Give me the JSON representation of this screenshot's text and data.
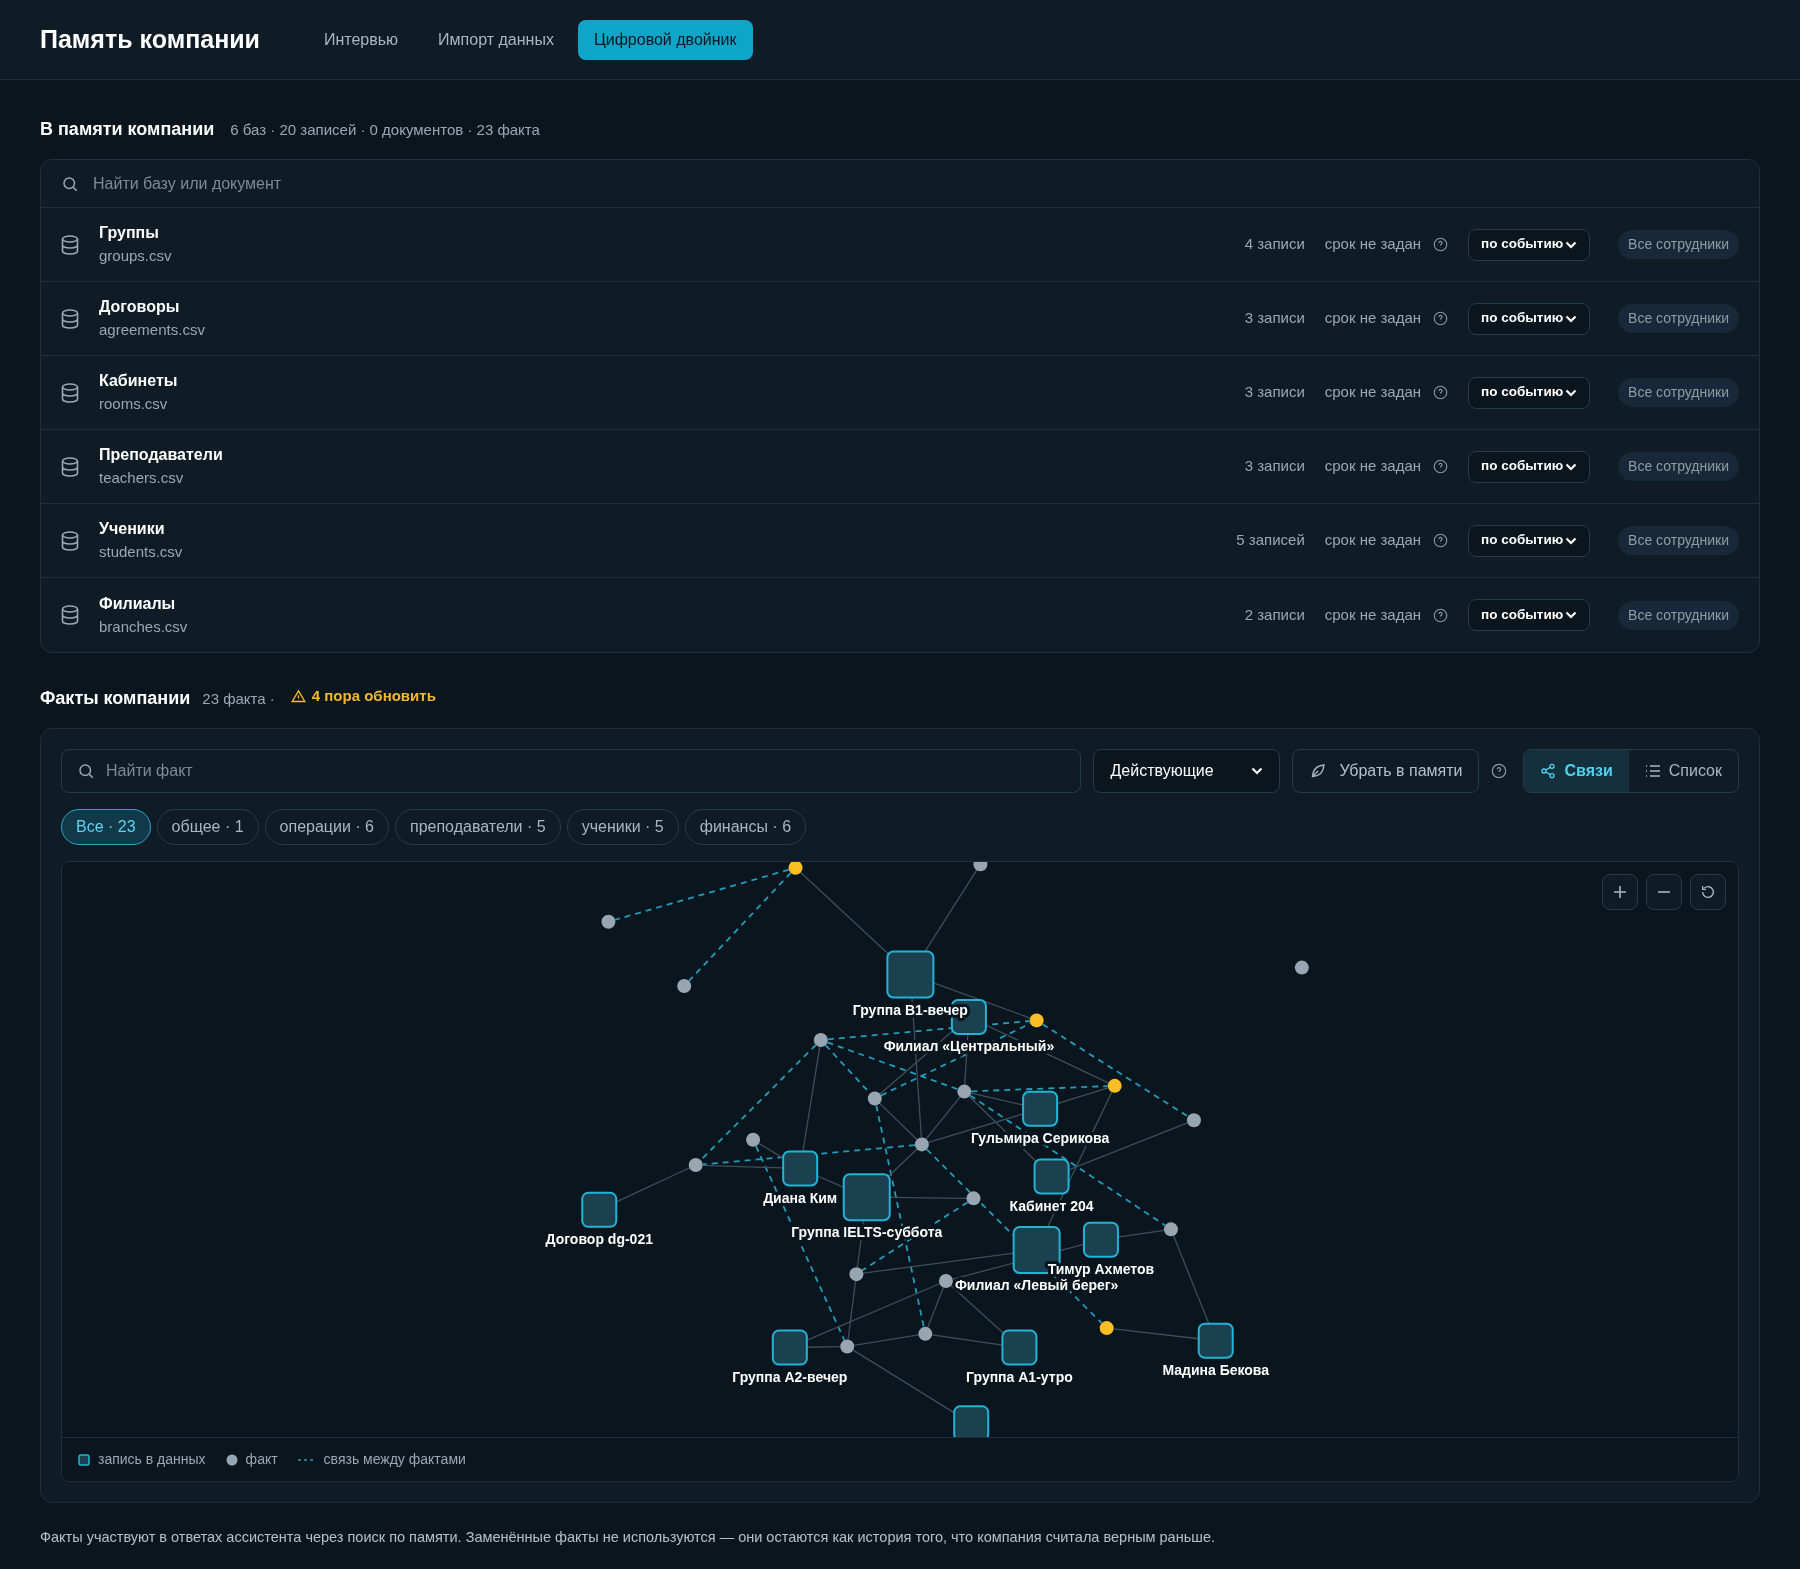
{
  "app": {
    "title": "Память компании",
    "tabs": [
      {
        "label": "Интервью",
        "selected": false
      },
      {
        "label": "Импорт данных",
        "selected": false
      },
      {
        "label": "Цифровой двойник",
        "selected": true
      }
    ]
  },
  "memory": {
    "title": "В памяти компании",
    "summary": "6 баз · 20 записей · 0 документов · 23 факта",
    "search": {
      "placeholder": "Найти базу или документ"
    },
    "bases": [
      {
        "name": "Группы",
        "file": "groups.csv",
        "count": "4 записи",
        "term": "срок не задан",
        "trigger": "по событию",
        "access": "Все сотрудники"
      },
      {
        "name": "Договоры",
        "file": "agreements.csv",
        "count": "3 записи",
        "term": "срок не задан",
        "trigger": "по событию",
        "access": "Все сотрудники"
      },
      {
        "name": "Кабинеты",
        "file": "rooms.csv",
        "count": "3 записи",
        "term": "срок не задан",
        "trigger": "по событию",
        "access": "Все сотрудники"
      },
      {
        "name": "Преподаватели",
        "file": "teachers.csv",
        "count": "3 записи",
        "term": "срок не задан",
        "trigger": "по событию",
        "access": "Все сотрудники"
      },
      {
        "name": "Ученики",
        "file": "students.csv",
        "count": "5 записей",
        "term": "срок не задан",
        "trigger": "по событию",
        "access": "Все сотрудники"
      },
      {
        "name": "Филиалы",
        "file": "branches.csv",
        "count": "2 записи",
        "term": "срок не задан",
        "trigger": "по событию",
        "access": "Все сотрудники"
      }
    ]
  },
  "facts": {
    "title": "Факты компании",
    "count": "23 факта ·",
    "warning": "4 пора обновить",
    "search": {
      "placeholder": "Найти факт"
    },
    "status_filter": "Действующие",
    "hide_button": "Убрать в памяти",
    "views": [
      {
        "label": "Связи",
        "selected": true
      },
      {
        "label": "Список",
        "selected": false
      }
    ],
    "categories": [
      {
        "label": "Все · 23",
        "selected": true
      },
      {
        "label": "общее · 1",
        "selected": false
      },
      {
        "label": "операции · 6",
        "selected": false
      },
      {
        "label": "преподаватели · 5",
        "selected": false
      },
      {
        "label": "ученики · 5",
        "selected": false
      },
      {
        "label": "финансы · 6",
        "selected": false
      }
    ],
    "graph": {
      "nodes": [
        {
          "kind": "record",
          "label": "Группа B1-вечер"
        },
        {
          "kind": "record",
          "label": "Филиал «Центральный»"
        },
        {
          "kind": "record",
          "label": "Гульмира Серикова"
        },
        {
          "kind": "record",
          "label": "Диана Ким"
        },
        {
          "kind": "record",
          "label": "Группа IELTS-суббота"
        },
        {
          "kind": "record",
          "label": "Кабинет 204"
        },
        {
          "kind": "record",
          "label": "Филиал «Левый берег»"
        },
        {
          "kind": "record",
          "label": "Тимур Ахметов"
        },
        {
          "kind": "record",
          "label": "Договор dg-021"
        },
        {
          "kind": "record",
          "label": "Группа A2-вечер"
        },
        {
          "kind": "record",
          "label": "Группа A1-утро"
        },
        {
          "kind": "record",
          "label": "Мадина Бекова"
        },
        {
          "kind": "record"
        },
        {
          "kind": "fact",
          "stale": true
        },
        {
          "kind": "fact",
          "stale": false
        },
        {
          "kind": "fact",
          "stale": false
        },
        {
          "kind": "fact",
          "stale": false
        },
        {
          "kind": "fact",
          "stale": false
        },
        {
          "kind": "fact",
          "stale": true
        },
        {
          "kind": "fact",
          "stale": false
        },
        {
          "kind": "fact",
          "stale": false
        },
        {
          "kind": "fact",
          "stale": false
        },
        {
          "kind": "fact",
          "stale": true
        },
        {
          "kind": "fact",
          "stale": false
        },
        {
          "kind": "fact",
          "stale": false
        },
        {
          "kind": "fact",
          "stale": false
        },
        {
          "kind": "fact",
          "stale": false
        },
        {
          "kind": "fact",
          "stale": false
        },
        {
          "kind": "fact",
          "stale": false
        },
        {
          "kind": "fact",
          "stale": false
        },
        {
          "kind": "fact",
          "stale": false
        },
        {
          "kind": "fact",
          "stale": true
        },
        {
          "kind": "fact",
          "stale": false
        },
        {
          "kind": "fact",
          "stale": false
        }
      ]
    },
    "legend": [
      {
        "kind": "record",
        "label": "запись в данных"
      },
      {
        "kind": "fact",
        "label": "факт"
      },
      {
        "kind": "link",
        "label": "связь между фактами"
      }
    ]
  },
  "footer": "Факты участвуют в ответах ассистента через поиск по памяти. Заменённые факты не используются — они остаются как история того, что компания считала верным раньше."
}
